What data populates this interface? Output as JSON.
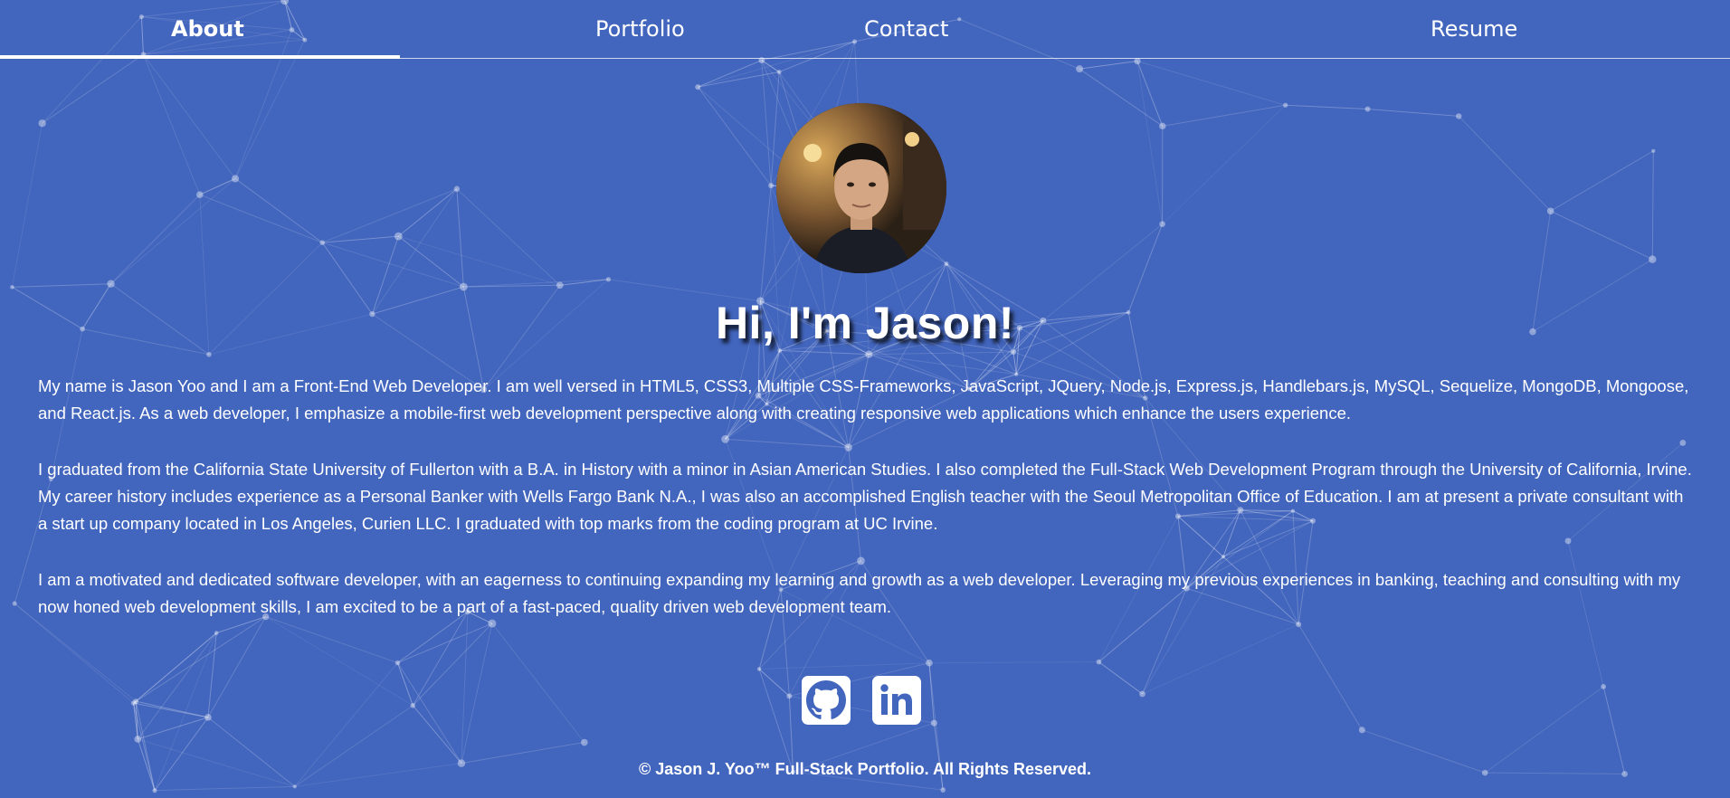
{
  "nav": {
    "tabs": [
      {
        "label": "About",
        "active": true
      },
      {
        "label": "Portfolio",
        "active": false
      },
      {
        "label": "Contact",
        "active": false
      },
      {
        "label": "Resume",
        "active": false
      }
    ]
  },
  "hero": {
    "title": "Hi, I'm Jason!"
  },
  "bio": {
    "paragraphs": [
      "My name is Jason Yoo and I am a Front-End Web Developer. I am well versed in HTML5, CSS3, Multiple CSS-Frameworks, JavaScript, JQuery, Node.js, Express.js, Handlebars.js, MySQL, Sequelize, MongoDB, Mongoose, and React.js. As a web developer, I emphasize a mobile-first web development perspective along with creating responsive web applications which enhance the users experience.",
      "I graduated from the California State University of Fullerton with a B.A. in History with a minor in Asian American Studies. I also completed the Full-Stack Web Development Program through the University of California, Irvine. My career history includes experience as a Personal Banker with Wells Fargo Bank N.A., I was also an accomplished English teacher with the Seoul Metropolitan Office of Education. I am at present a private consultant with a start up company located in Los Angeles, Curien LLC. I graduated with top marks from the coding program at UC Irvine.",
      "I am a motivated and dedicated software developer, with an eagerness to continuing expanding my learning and growth as a web developer. Leveraging my previous experiences in banking, teaching and consulting with my now honed web development skills, I am excited to be a part of a fast-paced, quality driven web development team."
    ]
  },
  "social": {
    "icons": [
      "github-icon",
      "linkedin-icon"
    ]
  },
  "footer": {
    "text": "© Jason J. Yoo™ Full-Stack Portfolio. All Rights Reserved."
  },
  "colors": {
    "background": "#4265bd",
    "text": "#ffffff"
  }
}
